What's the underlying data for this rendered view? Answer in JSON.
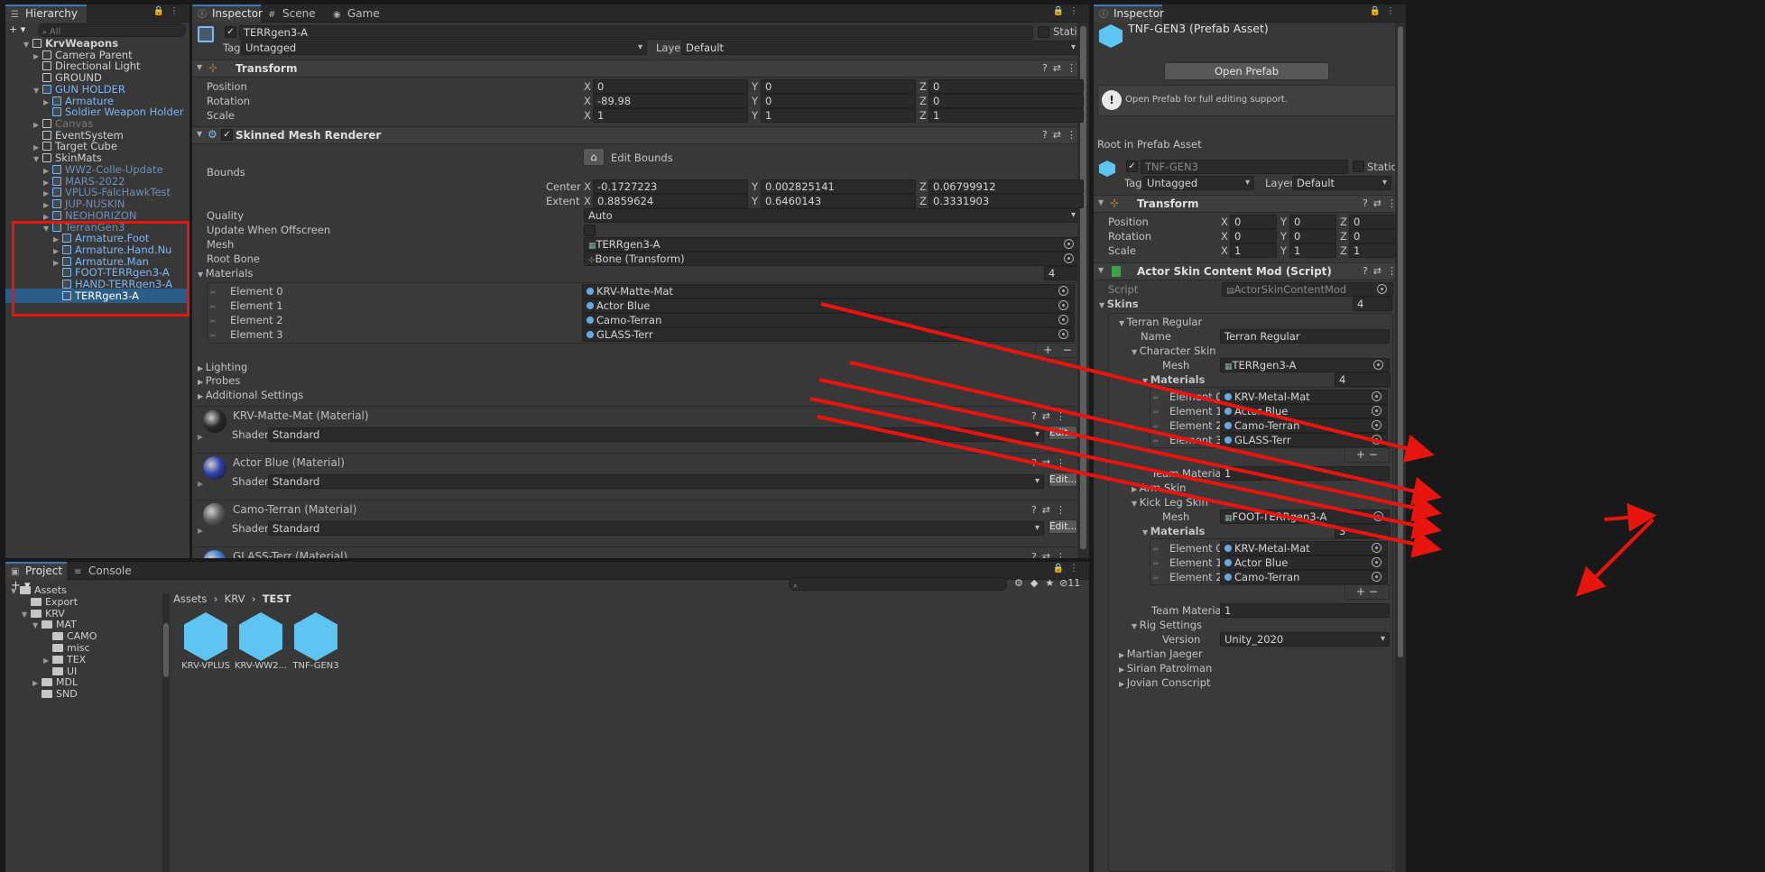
{
  "hierarchy": {
    "tab": "Hierarchy",
    "search_placeholder": "All",
    "add_label": "+ ▾",
    "items": [
      {
        "label": "KrvWeapons",
        "depth": 0,
        "arrow": "▼",
        "icon": "scene",
        "style": "bold"
      },
      {
        "label": "Camera Parent",
        "depth": 1,
        "arrow": "▶",
        "icon": "cube",
        "style": ""
      },
      {
        "label": "Directional Light",
        "depth": 1,
        "arrow": "",
        "icon": "cube",
        "style": ""
      },
      {
        "label": "GROUND",
        "depth": 1,
        "arrow": "",
        "icon": "cube",
        "style": ""
      },
      {
        "label": "GUN HOLDER",
        "depth": 1,
        "arrow": "▼",
        "icon": "cube-blue",
        "style": "blue"
      },
      {
        "label": "Armature",
        "depth": 2,
        "arrow": "▶",
        "icon": "cube",
        "style": "blue"
      },
      {
        "label": "Soldier Weapon Holder",
        "depth": 2,
        "arrow": "",
        "icon": "cube",
        "style": "blue"
      },
      {
        "label": "Canvas",
        "depth": 1,
        "arrow": "▶",
        "icon": "cube",
        "style": "gray"
      },
      {
        "label": "EventSystem",
        "depth": 1,
        "arrow": "",
        "icon": "cube",
        "style": ""
      },
      {
        "label": "Target Cube",
        "depth": 1,
        "arrow": "▶",
        "icon": "cube",
        "style": ""
      },
      {
        "label": "SkinMats",
        "depth": 1,
        "arrow": "▼",
        "icon": "cube",
        "style": ""
      },
      {
        "label": "WW2-Colle-Update",
        "depth": 2,
        "arrow": "▶",
        "icon": "cube-blue",
        "style": "dim"
      },
      {
        "label": "MARS-2022",
        "depth": 2,
        "arrow": "▶",
        "icon": "cube-blue",
        "style": "dim"
      },
      {
        "label": "VPLUS-FalcHawkTest",
        "depth": 2,
        "arrow": "▶",
        "icon": "cube-blue",
        "style": "dim"
      },
      {
        "label": "JUP-NUSKIN",
        "depth": 2,
        "arrow": "▶",
        "icon": "cube-blue",
        "style": "dim"
      },
      {
        "label": "NEOHORIZON",
        "depth": 2,
        "arrow": "▶",
        "icon": "cube-blue",
        "style": "dim"
      },
      {
        "label": "TerranGen3",
        "depth": 2,
        "arrow": "▼",
        "icon": "cube-blue",
        "style": "dim"
      },
      {
        "label": "Armature.Foot",
        "depth": 3,
        "arrow": "▶",
        "icon": "cube",
        "style": "blue"
      },
      {
        "label": "Armature.Hand.Nu",
        "depth": 3,
        "arrow": "▶",
        "icon": "cube",
        "style": "blue"
      },
      {
        "label": "Armature.Man",
        "depth": 3,
        "arrow": "▶",
        "icon": "cube",
        "style": "blue"
      },
      {
        "label": "FOOT-TERRgen3-A",
        "depth": 3,
        "arrow": "",
        "icon": "cube",
        "style": "blue"
      },
      {
        "label": "HAND-TERRgen3-A",
        "depth": 3,
        "arrow": "",
        "icon": "cube",
        "style": "blue"
      },
      {
        "label": "TERRgen3-A",
        "depth": 3,
        "arrow": "",
        "icon": "cube",
        "style": "selected"
      }
    ]
  },
  "center": {
    "tabs": [
      {
        "label": "Inspector",
        "icon": "ⓘ"
      },
      {
        "label": "Scene",
        "icon": "#"
      },
      {
        "label": "Game",
        "icon": "◉"
      }
    ],
    "object_name": "TERRgen3-A",
    "static_label": "Static",
    "tag_label": "Tag",
    "tag_value": "Untagged",
    "layer_label": "Layer",
    "layer_value": "Default",
    "transform": {
      "title": "Transform",
      "rows": [
        {
          "label": "Position",
          "x": "0",
          "y": "0",
          "z": "0"
        },
        {
          "label": "Rotation",
          "x": "-89.98",
          "y": "0",
          "z": "0"
        },
        {
          "label": "Scale",
          "x": "1",
          "y": "1",
          "z": "1"
        }
      ]
    },
    "smr": {
      "title": "Skinned Mesh Renderer",
      "edit_bounds": "Edit Bounds",
      "bounds_label": "Bounds",
      "center_label": "Center",
      "center": {
        "x": "-0.1727223",
        "y": "0.002825141",
        "z": "0.06799912"
      },
      "extent_label": "Extent",
      "extent": {
        "x": "0.8859624",
        "y": "0.6460143",
        "z": "0.3331903"
      },
      "quality_label": "Quality",
      "quality_value": "Auto",
      "offscreen_label": "Update When Offscreen",
      "mesh_label": "Mesh",
      "mesh_value": "TERRgen3-A",
      "rootbone_label": "Root Bone",
      "rootbone_value": "Bone (Transform)",
      "materials_label": "Materials",
      "materials_count": "4",
      "elements": [
        {
          "label": "Element 0",
          "value": "KRV-Matte-Mat"
        },
        {
          "label": "Element 1",
          "value": "Actor Blue"
        },
        {
          "label": "Element 2",
          "value": "Camo-Terran"
        },
        {
          "label": "Element 3",
          "value": "GLASS-Terr"
        }
      ],
      "lighting": "Lighting",
      "probes": "Probes",
      "additional": "Additional Settings"
    },
    "materials": [
      {
        "title": "KRV-Matte-Mat (Material)",
        "shader_label": "Shader",
        "shader": "Standard",
        "edit": "Edit...",
        "ball": "#2a2a2a"
      },
      {
        "title": "Actor Blue (Material)",
        "shader_label": "Shader",
        "shader": "Standard",
        "edit": "Edit...",
        "ball": "#2d3fa8"
      },
      {
        "title": "Camo-Terran (Material)",
        "shader_label": "Shader",
        "shader": "Standard",
        "edit": "Edit...",
        "ball": "#5a5a5a"
      },
      {
        "title": "GLASS-Terr (Material)",
        "shader_label": "",
        "shader": "",
        "edit": "",
        "ball": "#3a7ad0"
      }
    ]
  },
  "right": {
    "tab": "Inspector",
    "prefab_title": "TNF-GEN3 (Prefab Asset)",
    "open_prefab": "Open Prefab",
    "help_text": "Open Prefab for full editing support.",
    "root_label": "Root in Prefab Asset",
    "object_name": "TNF-GEN3",
    "static_label": "Static",
    "tag_label": "Tag",
    "tag_value": "Untagged",
    "layer_label": "Layer",
    "layer_value": "Default",
    "transform": {
      "title": "Transform",
      "rows": [
        {
          "label": "Position",
          "x": "0",
          "y": "0",
          "z": "0"
        },
        {
          "label": "Rotation",
          "x": "0",
          "y": "0",
          "z": "0"
        },
        {
          "label": "Scale",
          "x": "1",
          "y": "1",
          "z": "1"
        }
      ]
    },
    "script_comp": {
      "title": "Actor Skin Content Mod (Script)",
      "script_label": "Script",
      "script_value": "ActorSkinContentMod",
      "skins_label": "Skins",
      "skins_count": "4",
      "skin_name": "Terran Regular",
      "name_label": "Name",
      "name_value": "Terran Regular",
      "char_skin": "Character Skin",
      "mesh_label": "Mesh",
      "char_mesh": "TERRgen3-A",
      "materials_label": "Materials",
      "char_mat_count": "4",
      "char_elements": [
        {
          "label": "Element 0",
          "value": "KRV-Metal-Mat"
        },
        {
          "label": "Element 1",
          "value": "Actor Blue"
        },
        {
          "label": "Element 2",
          "value": "Camo-Terran"
        },
        {
          "label": "Element 3",
          "value": "GLASS-Terr"
        }
      ],
      "team_material_label": "Team Material",
      "team_material_1": "1",
      "arm_skin": "Arm Skin",
      "kick_skin": "Kick Leg Skin",
      "kick_mesh": "FOOT-TERRgen3-A",
      "kick_mat_count": "3",
      "kick_elements": [
        {
          "label": "Element 0",
          "value": "KRV-Metal-Mat"
        },
        {
          "label": "Element 1",
          "value": "Actor Blue"
        },
        {
          "label": "Element 2",
          "value": "Camo-Terran"
        }
      ],
      "team_material_2": "1",
      "rig_settings": "Rig Settings",
      "version_label": "Version",
      "version_value": "Unity_2020",
      "other_skins": [
        "Martian Jaeger",
        "Sirian Patrolman",
        "Jovian Conscript"
      ]
    }
  },
  "project": {
    "tabs": [
      {
        "label": "Project",
        "icon": "▣"
      },
      {
        "label": "Console",
        "icon": "≡"
      }
    ],
    "breadcrumb": [
      "Assets",
      "KRV",
      "TEST"
    ],
    "count": "11",
    "tree": [
      {
        "label": "Assets",
        "depth": 0,
        "arrow": "▼"
      },
      {
        "label": "Export",
        "depth": 1,
        "arrow": ""
      },
      {
        "label": "KRV",
        "depth": 1,
        "arrow": "▼"
      },
      {
        "label": "MAT",
        "depth": 2,
        "arrow": "▼"
      },
      {
        "label": "CAMO",
        "depth": 3,
        "arrow": ""
      },
      {
        "label": "misc",
        "depth": 3,
        "arrow": ""
      },
      {
        "label": "TEX",
        "depth": 3,
        "arrow": "▶"
      },
      {
        "label": "UI",
        "depth": 3,
        "arrow": ""
      },
      {
        "label": "MDL",
        "depth": 2,
        "arrow": "▶"
      },
      {
        "label": "SND",
        "depth": 2,
        "arrow": ""
      }
    ],
    "assets": [
      "KRV-VPLUS",
      "KRV-WW2...",
      "TNF-GEN3"
    ]
  },
  "colors": {
    "accent": "#3a79bb",
    "annotation": "#e8140e",
    "prefab_blue": "#5ec4f2"
  }
}
